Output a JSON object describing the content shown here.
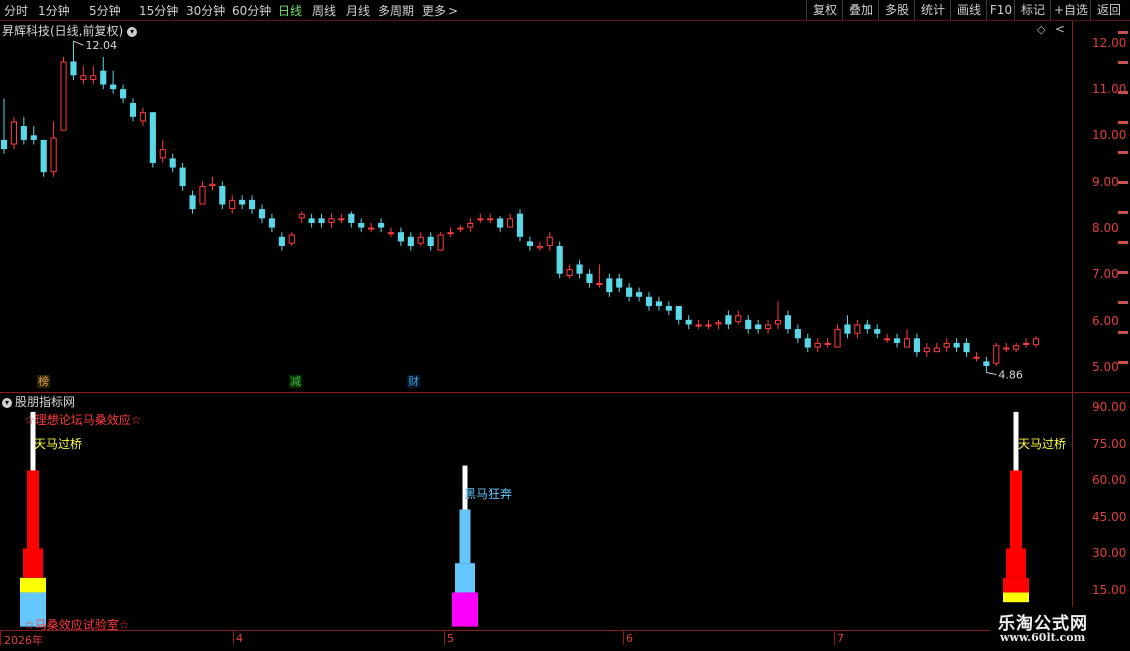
{
  "toolbar": {
    "left_items": [
      "分时",
      "1分钟",
      "5分钟",
      "15分钟",
      "30分钟",
      "60分钟",
      "日线",
      "周线",
      "月线",
      "多周期",
      "更多"
    ],
    "active_item": "日线",
    "right_items": [
      "复权",
      "叠加",
      "多股",
      "统计",
      "画线",
      "F10",
      "标记",
      "+自选",
      "返回"
    ]
  },
  "stock": {
    "title": "昇辉科技(日线,前复权)",
    "high_label": "12.04",
    "low_label": "4.86"
  },
  "price_axis": [
    "12.00",
    "11.00",
    "10.00",
    "9.00",
    "8.00",
    "7.00",
    "6.00",
    "5.00"
  ],
  "markers": [
    {
      "text": "榜",
      "color": "#e0a040"
    },
    {
      "text": "减",
      "color": "#40c040"
    },
    {
      "text": "财",
      "color": "#40a0e0"
    }
  ],
  "indicator": {
    "title": "股朋指标网",
    "axis": [
      "90.00",
      "75.00",
      "60.00",
      "45.00",
      "30.00",
      "15.00"
    ],
    "labels": {
      "top_left": "☆理想论坛马桑效应☆",
      "bottom_left": "☆马桑效应试验室☆",
      "tianma_1": "天马过桥",
      "heima": "黑马狂奔",
      "tianma_2": "天马过桥"
    }
  },
  "date_axis": [
    "2026年",
    "4",
    "5",
    "6",
    "7"
  ],
  "watermark": {
    "title": "乐淘公式网",
    "url": "www.60lt.com"
  },
  "colors": {
    "up": "#ff3c3c",
    "down": "#5ad8e8",
    "grid": "#8a1c1c",
    "axis_text": "#e04040"
  },
  "chart_data": {
    "type": "candlestick",
    "title": "昇辉科技(日线,前复权)",
    "ylim": [
      4.7,
      12.4
    ],
    "candles": [
      [
        9.9,
        9.7,
        10.8,
        9.6
      ],
      [
        9.8,
        10.3,
        10.4,
        9.7
      ],
      [
        10.2,
        9.9,
        10.4,
        9.8
      ],
      [
        10.0,
        9.9,
        10.2,
        9.8
      ],
      [
        9.9,
        9.2,
        9.9,
        9.1
      ],
      [
        9.2,
        9.95,
        10.3,
        9.1
      ],
      [
        10.1,
        11.6,
        11.7,
        10.1
      ],
      [
        11.6,
        11.3,
        12.04,
        11.2
      ],
      [
        11.2,
        11.3,
        11.5,
        11.1
      ],
      [
        11.2,
        11.3,
        11.5,
        11.1
      ],
      [
        11.4,
        11.1,
        11.7,
        11.0
      ],
      [
        11.1,
        11.0,
        11.4,
        10.9
      ],
      [
        11.0,
        10.8,
        11.1,
        10.7
      ],
      [
        10.7,
        10.4,
        10.8,
        10.3
      ],
      [
        10.3,
        10.5,
        10.6,
        10.2
      ],
      [
        10.5,
        9.4,
        10.5,
        9.3
      ],
      [
        9.5,
        9.7,
        9.9,
        9.4
      ],
      [
        9.5,
        9.3,
        9.6,
        9.2
      ],
      [
        9.3,
        8.9,
        9.4,
        8.8
      ],
      [
        8.7,
        8.4,
        8.8,
        8.3
      ],
      [
        8.5,
        8.9,
        9.0,
        8.5
      ],
      [
        8.9,
        8.95,
        9.1,
        8.8
      ],
      [
        8.9,
        8.5,
        9.0,
        8.4
      ],
      [
        8.4,
        8.6,
        8.7,
        8.3
      ],
      [
        8.6,
        8.5,
        8.7,
        8.4
      ],
      [
        8.6,
        8.4,
        8.7,
        8.3
      ],
      [
        8.4,
        8.2,
        8.5,
        8.1
      ],
      [
        8.2,
        8.0,
        8.3,
        7.9
      ],
      [
        7.8,
        7.6,
        7.9,
        7.5
      ],
      [
        7.65,
        7.85,
        7.9,
        7.6
      ],
      [
        8.2,
        8.3,
        8.35,
        8.1
      ],
      [
        8.2,
        8.1,
        8.3,
        8.0
      ],
      [
        8.2,
        8.1,
        8.3,
        8.0
      ],
      [
        8.1,
        8.2,
        8.3,
        8.0
      ],
      [
        8.2,
        8.2,
        8.3,
        8.1
      ],
      [
        8.3,
        8.1,
        8.35,
        8.0
      ],
      [
        8.1,
        8.0,
        8.2,
        7.9
      ],
      [
        8.0,
        8.0,
        8.1,
        7.9
      ],
      [
        8.1,
        8.0,
        8.2,
        7.9
      ],
      [
        7.9,
        7.9,
        8.0,
        7.8
      ],
      [
        7.9,
        7.7,
        8.0,
        7.6
      ],
      [
        7.8,
        7.6,
        7.9,
        7.5
      ],
      [
        7.65,
        7.8,
        7.9,
        7.6
      ],
      [
        7.8,
        7.6,
        7.9,
        7.5
      ],
      [
        7.5,
        7.85,
        7.9,
        7.5
      ],
      [
        7.9,
        7.9,
        8.0,
        7.8
      ],
      [
        8.0,
        8.0,
        8.05,
        7.9
      ],
      [
        8.0,
        8.1,
        8.2,
        7.9
      ],
      [
        8.2,
        8.2,
        8.3,
        8.1
      ],
      [
        8.2,
        8.2,
        8.3,
        8.1
      ],
      [
        8.2,
        8.0,
        8.25,
        7.9
      ],
      [
        8.0,
        8.2,
        8.3,
        8.0
      ],
      [
        8.3,
        7.8,
        8.4,
        7.7
      ],
      [
        7.7,
        7.6,
        7.8,
        7.5
      ],
      [
        7.55,
        7.6,
        7.7,
        7.5
      ],
      [
        7.6,
        7.8,
        7.9,
        7.5
      ],
      [
        7.6,
        7.0,
        7.7,
        6.9
      ],
      [
        6.95,
        7.1,
        7.2,
        6.9
      ],
      [
        7.2,
        7.0,
        7.3,
        6.9
      ],
      [
        7.0,
        6.8,
        7.1,
        6.7
      ],
      [
        6.8,
        6.8,
        7.2,
        6.7
      ],
      [
        6.9,
        6.6,
        7.0,
        6.5
      ],
      [
        6.9,
        6.7,
        7.0,
        6.6
      ],
      [
        6.7,
        6.5,
        6.8,
        6.4
      ],
      [
        6.6,
        6.5,
        6.7,
        6.4
      ],
      [
        6.5,
        6.3,
        6.6,
        6.2
      ],
      [
        6.4,
        6.3,
        6.5,
        6.2
      ],
      [
        6.3,
        6.2,
        6.4,
        6.1
      ],
      [
        6.3,
        6.0,
        6.3,
        5.9
      ],
      [
        6.0,
        5.9,
        6.1,
        5.8
      ],
      [
        5.9,
        5.9,
        6.0,
        5.8
      ],
      [
        5.9,
        5.9,
        6.0,
        5.8
      ],
      [
        5.9,
        5.95,
        6.0,
        5.8
      ],
      [
        6.1,
        5.9,
        6.2,
        5.8
      ],
      [
        5.95,
        6.1,
        6.2,
        5.9
      ],
      [
        6.0,
        5.8,
        6.1,
        5.7
      ],
      [
        5.9,
        5.8,
        6.0,
        5.7
      ],
      [
        5.8,
        5.9,
        6.0,
        5.7
      ],
      [
        5.9,
        6.0,
        6.4,
        5.8
      ],
      [
        6.1,
        5.8,
        6.2,
        5.7
      ],
      [
        5.8,
        5.6,
        5.9,
        5.5
      ],
      [
        5.6,
        5.4,
        5.7,
        5.3
      ],
      [
        5.4,
        5.5,
        5.6,
        5.3
      ],
      [
        5.5,
        5.5,
        5.6,
        5.4
      ],
      [
        5.4,
        5.8,
        5.9,
        5.4
      ],
      [
        5.9,
        5.7,
        6.1,
        5.6
      ],
      [
        5.7,
        5.9,
        6.0,
        5.6
      ],
      [
        5.9,
        5.8,
        6.0,
        5.7
      ],
      [
        5.8,
        5.7,
        5.9,
        5.6
      ],
      [
        5.6,
        5.6,
        5.7,
        5.5
      ],
      [
        5.6,
        5.5,
        5.7,
        5.4
      ],
      [
        5.4,
        5.6,
        5.8,
        5.4
      ],
      [
        5.6,
        5.3,
        5.7,
        5.2
      ],
      [
        5.3,
        5.4,
        5.5,
        5.2
      ],
      [
        5.3,
        5.4,
        5.5,
        5.3
      ],
      [
        5.4,
        5.5,
        5.6,
        5.3
      ],
      [
        5.5,
        5.4,
        5.6,
        5.3
      ],
      [
        5.5,
        5.3,
        5.6,
        5.2
      ],
      [
        5.2,
        5.2,
        5.3,
        5.1
      ],
      [
        5.1,
        5.0,
        5.2,
        4.86
      ],
      [
        5.05,
        5.45,
        5.5,
        5.0
      ],
      [
        5.4,
        5.4,
        5.5,
        5.3
      ],
      [
        5.35,
        5.45,
        5.5,
        5.3
      ],
      [
        5.5,
        5.5,
        5.6,
        5.4
      ],
      [
        5.45,
        5.6,
        5.65,
        5.4
      ]
    ],
    "indicator": {
      "ylim": [
        0,
        96
      ],
      "y_ticks": [
        90,
        75,
        60,
        45,
        30,
        15
      ],
      "signals": [
        {
          "label": "天马过桥",
          "segments": [
            [
              0,
              14,
              "#64c8ff"
            ],
            [
              14,
              20,
              "#ffff00"
            ],
            [
              20,
              32,
              "#ff0000"
            ],
            [
              32,
              64,
              "#ff0000"
            ],
            [
              64,
              88,
              "#ffffff"
            ]
          ]
        },
        {
          "label": "黑马狂奔",
          "segments": [
            [
              0,
              14,
              "#ff00ff"
            ],
            [
              14,
              26,
              "#64c8ff"
            ],
            [
              26,
              48,
              "#64c8ff"
            ],
            [
              48,
              56,
              "#ffffff"
            ],
            [
              56,
              66,
              "#ffffff"
            ]
          ]
        },
        {
          "label": "天马过桥",
          "segments": [
            [
              10,
              14,
              "#ffff00"
            ],
            [
              14,
              20,
              "#ff0000"
            ],
            [
              20,
              32,
              "#ff0000"
            ],
            [
              32,
              64,
              "#ff0000"
            ],
            [
              64,
              88,
              "#ffffff"
            ]
          ]
        }
      ]
    }
  }
}
